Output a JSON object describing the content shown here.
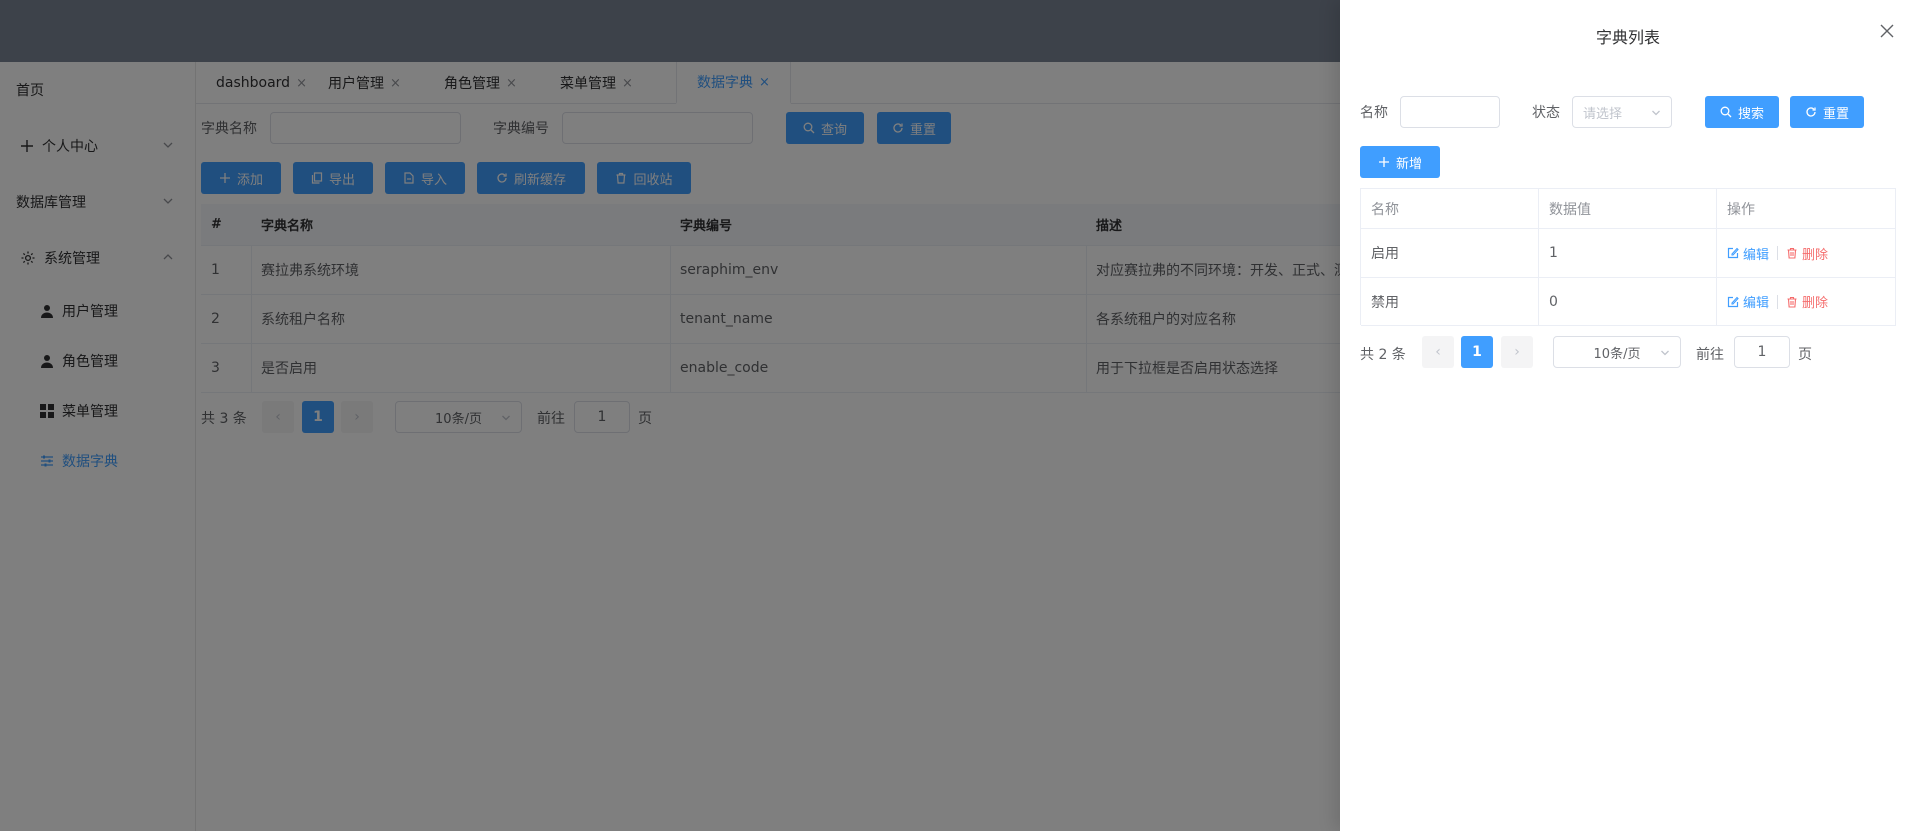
{
  "sidebar": {
    "home": "首页",
    "personal": "个人中心",
    "database": "数据库管理",
    "system": "系统管理",
    "sub": [
      {
        "label": "用户管理",
        "icon": "user-icon"
      },
      {
        "label": "角色管理",
        "icon": "user-icon"
      },
      {
        "label": "菜单管理",
        "icon": "grid-icon"
      },
      {
        "label": "数据字典",
        "icon": "sliders-icon",
        "active": true
      }
    ]
  },
  "tabs": [
    {
      "label": "dashboard"
    },
    {
      "label": "用户管理"
    },
    {
      "label": "角色管理"
    },
    {
      "label": "菜单管理"
    },
    {
      "label": "数据字典",
      "active": true
    }
  ],
  "tab_close": "×",
  "filter": {
    "dict_name_label": "字典名称",
    "dict_code_label": "字典编号",
    "query": "查询",
    "reset": "重置"
  },
  "toolbar": {
    "add": "添加",
    "export": "导出",
    "import": "导入",
    "refresh_cache": "刷新缓存",
    "recycle": "回收站"
  },
  "main_table": {
    "columns": [
      "#",
      "字典名称",
      "字典编号",
      "描述"
    ],
    "rows": [
      [
        "1",
        "赛拉弗系统环境",
        "seraphim_env",
        "对应赛拉弗的不同环境：开发、正式、测"
      ],
      [
        "2",
        "系统租户名称",
        "tenant_name",
        "各系统租户的对应名称"
      ],
      [
        "3",
        "是否启用",
        "enable_code",
        "用于下拉框是否启用状态选择"
      ]
    ]
  },
  "main_pagination": {
    "total": "共 3 条",
    "page": "1",
    "page_size": "10条/页",
    "goto": "前往",
    "goto_value": "1",
    "page_unit": "页"
  },
  "drawer": {
    "title": "字典列表",
    "name_label": "名称",
    "status_label": "状态",
    "status_placeholder": "请选择",
    "search": "搜索",
    "reset": "重置",
    "add": "新增",
    "table": {
      "columns": [
        "名称",
        "数据值",
        "操作"
      ],
      "rows": [
        {
          "name": "启用",
          "value": "1"
        },
        {
          "name": "禁用",
          "value": "0"
        }
      ],
      "edit": "编辑",
      "delete": "删除"
    },
    "pagination": {
      "total": "共 2 条",
      "page": "1",
      "page_size": "10条/页",
      "goto": "前往",
      "goto_value": "1",
      "page_unit": "页"
    }
  },
  "colors": {
    "primary": "#409eff",
    "danger": "#f56c6c",
    "overlay": "rgba(0,0,0,0.5)"
  }
}
